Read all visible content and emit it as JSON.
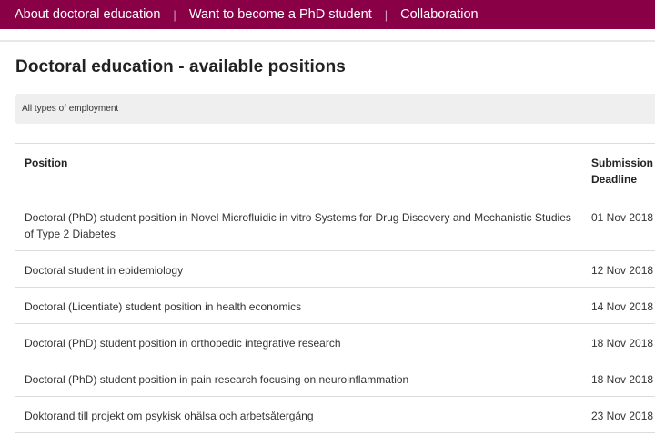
{
  "nav": {
    "items": [
      {
        "label": "About doctoral education"
      },
      {
        "label": "Want to become a PhD student"
      },
      {
        "label": "Collaboration"
      }
    ],
    "separator": "|",
    "background": "#8a0047"
  },
  "page": {
    "title": "Doctoral education - available positions"
  },
  "filter": {
    "selected": "All types of employment"
  },
  "table": {
    "headers": {
      "position": "Position",
      "deadline_line1": "Submission",
      "deadline_line2": "Deadline"
    },
    "rows": [
      {
        "position": "Doctoral (PhD) student position in Novel Microfluidic in vitro Systems for Drug Discovery and Mechanistic Studies of Type 2 Diabetes",
        "deadline": "01 Nov 2018"
      },
      {
        "position": "Doctoral student in epidemiology",
        "deadline": "12 Nov 2018"
      },
      {
        "position": "Doctoral (Licentiate) student position in health economics",
        "deadline": "14 Nov 2018"
      },
      {
        "position": "Doctoral (PhD) student position in orthopedic integrative research",
        "deadline": "18 Nov 2018"
      },
      {
        "position": "Doctoral (PhD) student position in pain research focusing on neuroinflammation",
        "deadline": "18 Nov 2018"
      },
      {
        "position": "Doktorand till projekt om psykisk ohälsa och arbetsåtergång",
        "deadline": "23 Nov 2018"
      }
    ]
  }
}
